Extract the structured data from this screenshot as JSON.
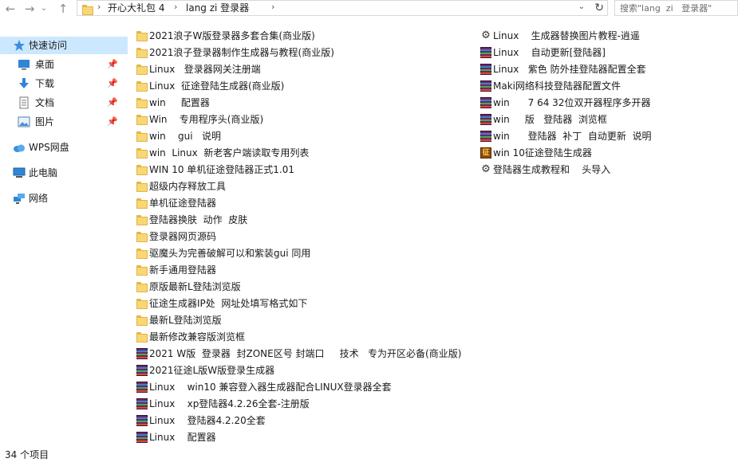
{
  "toolbar": {
    "back_icon": "arrow-left-icon",
    "forward_icon": "arrow-right-icon",
    "recent_icon": "chevron-down-icon",
    "up_icon": "arrow-up-icon"
  },
  "address": {
    "crumbs": [
      "开心大礼包 4",
      "lang  zi   登录器"
    ],
    "separator": "›"
  },
  "search": {
    "placeholder": "搜索\"lang  zi   登录器\""
  },
  "nav": {
    "quick_access": "快速访问",
    "desktop": "桌面",
    "downloads": "下载",
    "documents": "文档",
    "pictures": "图片",
    "wps": "WPS网盘",
    "this_pc": "此电脑",
    "network": "网络"
  },
  "files_left": [
    {
      "name": "2021浪子W版登录器多套合集(商业版)",
      "type": "folder"
    },
    {
      "name": "2021浪子登录器制作生成器与教程(商业版)",
      "type": "folder"
    },
    {
      "name": "Linux   登录器网关注册端",
      "type": "folder"
    },
    {
      "name": "Linux  征途登陆生成器(商业版)",
      "type": "folder"
    },
    {
      "name": "win     配置器",
      "type": "folder"
    },
    {
      "name": "Win    专用程序头(商业版)",
      "type": "folder"
    },
    {
      "name": "win    gui   说明",
      "type": "folder"
    },
    {
      "name": "win  Linux  新老客户端读取专用列表",
      "type": "folder"
    },
    {
      "name": "WIN 10 单机征途登陆器正式1.01",
      "type": "folder"
    },
    {
      "name": "超级内存释放工具",
      "type": "folder"
    },
    {
      "name": "单机征途登陆器",
      "type": "folder"
    },
    {
      "name": "登陆器换肤  动作  皮肤",
      "type": "folder"
    },
    {
      "name": "登录器网页源码",
      "type": "folder"
    },
    {
      "name": "驱魔头为完善破解可以和紫装gui 同用",
      "type": "folder"
    },
    {
      "name": "新手通用登陆器",
      "type": "folder"
    },
    {
      "name": "原版最新L登陆浏览版",
      "type": "folder"
    },
    {
      "name": "征途生成器IP处  网址处填写格式如下",
      "type": "folder"
    },
    {
      "name": "最新L登陆浏览版",
      "type": "folder"
    },
    {
      "name": "最新修改兼容版浏览框",
      "type": "folder"
    },
    {
      "name": "2021 W版  登录器  封ZONE区号 封端口     技术   专为开区必备(商业版)",
      "type": "archive"
    },
    {
      "name": "2021征途L版W版登录生成器",
      "type": "archive"
    },
    {
      "name": "Linux    win10 兼容登入器生成器配合LINUX登录器全套",
      "type": "archive"
    },
    {
      "name": "Linux    xp登陆器4.2.26全套-注册版",
      "type": "archive"
    },
    {
      "name": "Linux    登陆器4.2.20全套",
      "type": "archive"
    },
    {
      "name": "Linux    配置器",
      "type": "archive"
    }
  ],
  "files_right": [
    {
      "name": "Linux    生成器替换图片教程-逍遥",
      "type": "exe"
    },
    {
      "name": "Linux    自动更新[登陆器]",
      "type": "archive"
    },
    {
      "name": "Linux   紫色 防外挂登陆器配置全套",
      "type": "archive"
    },
    {
      "name": "Maki网络科技登陆器配置文件",
      "type": "archive"
    },
    {
      "name": "win      7 64 32位双开器程序多开器",
      "type": "archive"
    },
    {
      "name": "win     版   登陆器  浏览框",
      "type": "archive"
    },
    {
      "name": "win      登陆器  补丁  自动更新  说明",
      "type": "archive"
    },
    {
      "name": "win 10征途登陆生成器",
      "type": "app"
    },
    {
      "name": "登陆器生成教程和    头导入",
      "type": "exe"
    }
  ],
  "status": {
    "item_count": "34 个项目"
  }
}
